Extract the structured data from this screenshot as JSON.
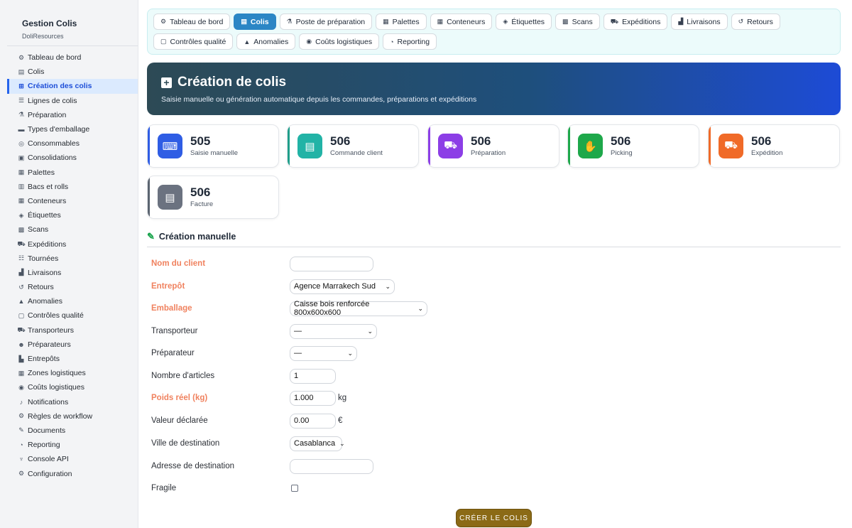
{
  "sidebar": {
    "title": "Gestion Colis",
    "subtitle": "DoliResources",
    "items": [
      {
        "label": "Tableau de bord",
        "icon": "⚙"
      },
      {
        "label": "Colis",
        "icon": "▤"
      },
      {
        "label": "Création des colis",
        "icon": "⊞",
        "active": true
      },
      {
        "label": "Lignes de colis",
        "icon": "☰"
      },
      {
        "label": "Préparation",
        "icon": "⚗"
      },
      {
        "label": "Types d'emballage",
        "icon": "▬"
      },
      {
        "label": "Consommables",
        "icon": "◎"
      },
      {
        "label": "Consolidations",
        "icon": "▣"
      },
      {
        "label": "Palettes",
        "icon": "▦"
      },
      {
        "label": "Bacs et rolls",
        "icon": "▥"
      },
      {
        "label": "Conteneurs",
        "icon": "▦"
      },
      {
        "label": "Étiquettes",
        "icon": "◈"
      },
      {
        "label": "Scans",
        "icon": "▩"
      },
      {
        "label": "Expéditions",
        "icon": "⛟"
      },
      {
        "label": "Tournées",
        "icon": "☷"
      },
      {
        "label": "Livraisons",
        "icon": "▟"
      },
      {
        "label": "Retours",
        "icon": "↺"
      },
      {
        "label": "Anomalies",
        "icon": "▲"
      },
      {
        "label": "Contrôles qualité",
        "icon": "▢"
      },
      {
        "label": "Transporteurs",
        "icon": "⛟"
      },
      {
        "label": "Préparateurs",
        "icon": "☻"
      },
      {
        "label": "Entrepôts",
        "icon": "▙"
      },
      {
        "label": "Zones logistiques",
        "icon": "▦"
      },
      {
        "label": "Coûts logistiques",
        "icon": "◉"
      },
      {
        "label": "Notifications",
        "icon": "♪"
      },
      {
        "label": "Règles de workflow",
        "icon": "⚙"
      },
      {
        "label": "Documents",
        "icon": "✎"
      },
      {
        "label": "Reporting",
        "icon": "◔"
      },
      {
        "label": "Console API",
        "icon": "♆"
      },
      {
        "label": "Configuration",
        "icon": "⚙"
      }
    ]
  },
  "tabs": {
    "row1": [
      {
        "label": "Tableau de bord",
        "icon": "⚙"
      },
      {
        "label": "Colis",
        "icon": "▤",
        "active": true
      },
      {
        "label": "Poste de préparation",
        "icon": "⚗"
      },
      {
        "label": "Palettes",
        "icon": "▦"
      },
      {
        "label": "Conteneurs",
        "icon": "▦"
      },
      {
        "label": "Étiquettes",
        "icon": "◈"
      },
      {
        "label": "Scans",
        "icon": "▩"
      },
      {
        "label": "Expéditions",
        "icon": "⛟"
      },
      {
        "label": "Livraisons",
        "icon": "▟"
      },
      {
        "label": "Retours",
        "icon": "↺"
      }
    ],
    "row2": [
      {
        "label": "Contrôles qualité",
        "icon": "▢"
      },
      {
        "label": "Anomalies",
        "icon": "▲"
      },
      {
        "label": "Coûts logistiques",
        "icon": "◉"
      },
      {
        "label": "Reporting",
        "icon": "◔"
      }
    ]
  },
  "hero": {
    "title": "Création de colis",
    "subtitle": "Saisie manuelle ou génération automatique depuis les commandes, préparations et expéditions"
  },
  "stats": [
    {
      "value": "505",
      "label": "Saisie manuelle",
      "color": "#2f5de4",
      "bar": "#2f5de4",
      "icon": "⌨"
    },
    {
      "value": "506",
      "label": "Commande client",
      "color": "#22b3a6",
      "bar": "#1f9e8a",
      "icon": "▤"
    },
    {
      "value": "506",
      "label": "Préparation",
      "color": "#8c3ee6",
      "bar": "#8c3ee6",
      "icon": "⛟"
    },
    {
      "value": "506",
      "label": "Picking",
      "color": "#1ea84a",
      "bar": "#1ea84a",
      "icon": "✋"
    },
    {
      "value": "506",
      "label": "Expédition",
      "color": "#f06a28",
      "bar": "#f06a28",
      "icon": "⛟"
    },
    {
      "value": "506",
      "label": "Facture",
      "color": "#6b7280",
      "bar": "#5b6470",
      "icon": "▤"
    }
  ],
  "section": {
    "title": "Création manuelle",
    "icon": "✎"
  },
  "form": {
    "client_label": "Nom du client",
    "client_value": "",
    "entrepot_label": "Entrepôt",
    "entrepot_value": "Agence Marrakech Sud",
    "emballage_label": "Emballage",
    "emballage_value": "Caisse bois renforcée 800x600x600",
    "transporteur_label": "Transporteur",
    "transporteur_value": "—",
    "preparateur_label": "Préparateur",
    "preparateur_value": "—",
    "articles_label": "Nombre d'articles",
    "articles_value": "1",
    "poids_label": "Poids réel (kg)",
    "poids_value": "1.000",
    "poids_unit": "kg",
    "valeur_label": "Valeur déclarée",
    "valeur_value": "0.00",
    "valeur_unit": "€",
    "ville_label": "Ville de destination",
    "ville_value": "Casablanca",
    "adresse_label": "Adresse de destination",
    "adresse_value": "",
    "fragile_label": "Fragile",
    "fragile_checked": false,
    "submit_label": "CRÉER LE COLIS"
  }
}
